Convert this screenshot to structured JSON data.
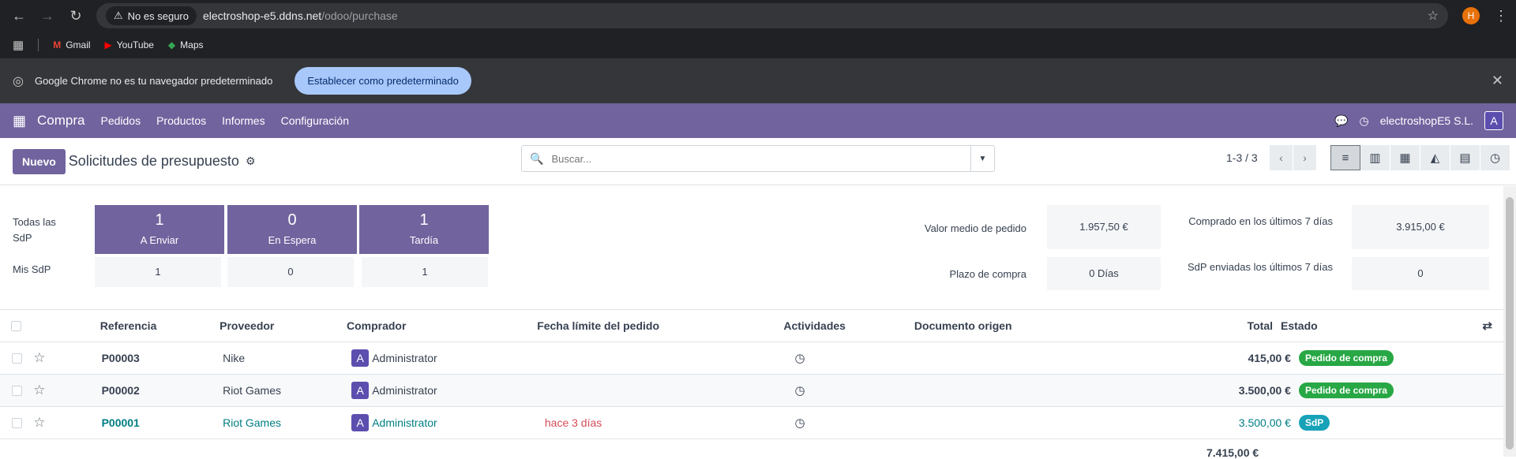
{
  "browser": {
    "insecure_label": "No es seguro",
    "url_host": "electroshop-e5.ddns.net",
    "url_path": "/odoo/purchase",
    "profile_initial": "H",
    "bookmarks": [
      {
        "label": "Gmail",
        "icon": "gmail-icon"
      },
      {
        "label": "YouTube",
        "icon": "youtube-icon"
      },
      {
        "label": "Maps",
        "icon": "maps-icon"
      }
    ],
    "infobar_text": "Google Chrome no es tu navegador predeterminado",
    "infobar_button": "Establecer como predeterminado"
  },
  "odoo_nav": {
    "app": "Compra",
    "menu": [
      "Pedidos",
      "Productos",
      "Informes",
      "Configuración"
    ],
    "company": "electroshopE5 S.L.",
    "user_initial": "A"
  },
  "control_panel": {
    "new_label": "Nuevo",
    "title": "Solicitudes de presupuesto",
    "search_placeholder": "Buscar...",
    "pager": "1-3 / 3"
  },
  "dashboard": {
    "all_label": "Todas las SdP",
    "my_label": "Mis SdP",
    "tiles": [
      {
        "count": "1",
        "label": "A Enviar",
        "mine": "1"
      },
      {
        "count": "0",
        "label": "En Espera",
        "mine": "0"
      },
      {
        "count": "1",
        "label": "Tardía",
        "mine": "1"
      }
    ],
    "kpis": {
      "avg_label": "Valor medio de pedido",
      "avg_value": "1.957,50 €",
      "lead_label": "Plazo de compra",
      "lead_value": "0 Días",
      "bought_label": "Comprado en los últimos 7 días",
      "bought_value": "3.915,00 €",
      "sent_label": "SdP enviadas los últimos 7 días",
      "sent_value": "0"
    }
  },
  "table": {
    "headers": {
      "ref": "Referencia",
      "vendor": "Proveedor",
      "buyer": "Comprador",
      "deadline": "Fecha límite del pedido",
      "activities": "Actividades",
      "origin": "Documento origen",
      "total": "Total",
      "status": "Estado"
    },
    "rows": [
      {
        "ref": "P00003",
        "vendor": "Nike",
        "buyer": "Administrator",
        "deadline": "",
        "total": "415,00 €",
        "status": "Pedido de compra"
      },
      {
        "ref": "P00002",
        "vendor": "Riot Games",
        "buyer": "Administrator",
        "deadline": "",
        "total": "3.500,00 €",
        "status": "Pedido de compra"
      },
      {
        "ref": "P00001",
        "vendor": "Riot Games",
        "buyer": "Administrator",
        "deadline": "hace 3 días",
        "total": "3.500,00 €",
        "status": "SdP"
      }
    ],
    "sum_total": "7.415,00 €"
  },
  "colors": {
    "brand": "#71639e",
    "badge_success": "#28a745",
    "badge_info": "#17a2b8"
  }
}
